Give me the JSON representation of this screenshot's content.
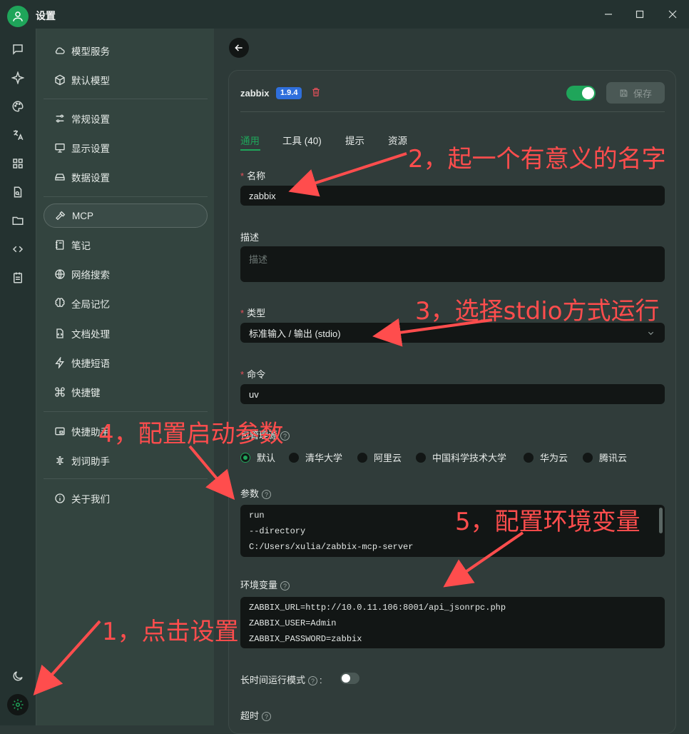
{
  "window": {
    "title": "设置"
  },
  "sidebar": {
    "items": [
      {
        "label": "模型服务"
      },
      {
        "label": "默认模型"
      },
      {
        "label": "常规设置"
      },
      {
        "label": "显示设置"
      },
      {
        "label": "数据设置"
      },
      {
        "label": "MCP"
      },
      {
        "label": "笔记"
      },
      {
        "label": "网络搜索"
      },
      {
        "label": "全局记忆"
      },
      {
        "label": "文档处理"
      },
      {
        "label": "快捷短语"
      },
      {
        "label": "快捷键"
      },
      {
        "label": "快捷助手"
      },
      {
        "label": "划词助手"
      },
      {
        "label": "关于我们"
      }
    ]
  },
  "server": {
    "name": "zabbix",
    "version": "1.9.4",
    "enabled": true,
    "save_label": "保存"
  },
  "tabs": [
    {
      "label": "通用"
    },
    {
      "label": "工具 (40)"
    },
    {
      "label": "提示"
    },
    {
      "label": "资源"
    }
  ],
  "form": {
    "name_label": "名称",
    "name_value": "zabbix",
    "desc_label": "描述",
    "desc_placeholder": "描述",
    "type_label": "类型",
    "type_value": "标准输入 / 输出 (stdio)",
    "command_label": "命令",
    "command_value": "uv",
    "source_label": "包管理源",
    "sources": [
      "默认",
      "清华大学",
      "阿里云",
      "中国科学技术大学",
      "华为云",
      "腾讯云"
    ],
    "source_selected": "默认",
    "args_label": "参数",
    "args": [
      "run",
      "--directory",
      "C:/Users/xulia/zabbix-mcp-server"
    ],
    "env_label": "环境变量",
    "env": [
      "ZABBIX_URL=http://10.0.11.106:8001/api_jsonrpc.php",
      "ZABBIX_USER=Admin",
      "ZABBIX_PASSWORD=zabbix"
    ],
    "longrun_label": "长时间运行模式",
    "longrun_colon": ":",
    "timeout_label": "超时"
  },
  "annotations": {
    "a1": "1，点击设置",
    "a2": "2，起一个有意义的名字",
    "a3": "3，选择stdio方式运行",
    "a4": "4，配置启动参数",
    "a5": "5，配置环境变量"
  },
  "colors": {
    "accent": "#1fa55a",
    "annotation": "#ff4d4d",
    "badge": "#2f6fdc",
    "delete": "#e6505a"
  }
}
